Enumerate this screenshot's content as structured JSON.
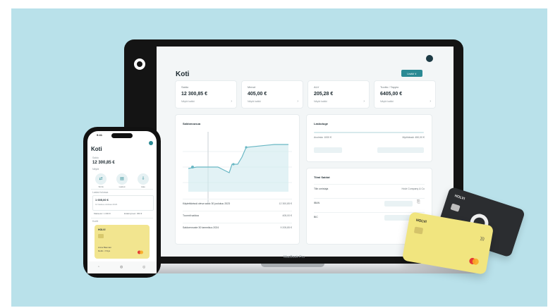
{
  "laptop": {
    "brand_label": "MacBook Pro",
    "page_title": "Koti",
    "top_button_label": "Lisää ∨",
    "kpis": [
      {
        "label": "Saldo",
        "value": "12 300,85 €",
        "sub": "Näytä kaikki"
      },
      {
        "label": "Menot",
        "value": "405,00 €",
        "sub": "Näytä kaikki"
      },
      {
        "label": "ALV",
        "value": "205,28 €",
        "sub": "Näytä kaikki"
      },
      {
        "label": "Tuotto / Tappio",
        "value": "6405,00 €",
        "sub": "Näytä kaikki"
      }
    ],
    "saldo_card": {
      "title": "Saldonousua",
      "rows": [
        {
          "label": "Käytettävissä oleva saldo 30 joulukuu 2023",
          "value": "12 300,85 €"
        },
        {
          "label": "Tuonnit saldoa",
          "value": "405,00 €"
        },
        {
          "label": "Saldoennuste 30 tammikuu 2024",
          "value": "9 205,85 €"
        }
      ]
    },
    "laskut_card": {
      "title": "Laskutuge",
      "left_text": "Avoimia: 1000 €",
      "right_text": "Myöhässä: 450,00 €"
    },
    "tiimi_card": {
      "title": "Tiimi Saldot",
      "rows": [
        {
          "label": "Tilin omistaja",
          "value": "Holvi Company & Co"
        },
        {
          "label": "IBAN",
          "value": ""
        },
        {
          "label": "BIC",
          "value": ""
        }
      ]
    }
  },
  "phone": {
    "time": "9:41",
    "title": "Koti",
    "saldo_label": "Saldo",
    "saldo_value": "12 300,85 €",
    "saldo_sub": "Näytä",
    "actions": [
      {
        "icon": "⇄",
        "label": "Siirrä"
      },
      {
        "icon": "▤",
        "label": "Laskut"
      },
      {
        "icon": "⇩",
        "label": "Hae"
      }
    ],
    "section_label": "Laskut tulossa",
    "box_value": "1 005,00 €",
    "box_sub": "14 laskua odottaa 2023",
    "mini_left": "Maksetut: 1 000 €",
    "mini_right": "Erääntyneet: 450 €",
    "cards_label": "Kortit",
    "card_brand": "HOLVI",
    "card_name": "Anna Bauman",
    "card_text": "Debit • Yritys",
    "tab_icons": [
      "◔",
      "◍",
      "◎"
    ]
  },
  "physical_cards": {
    "black_brand": "HOLVI",
    "yellow_brand": "HOLVI"
  }
}
